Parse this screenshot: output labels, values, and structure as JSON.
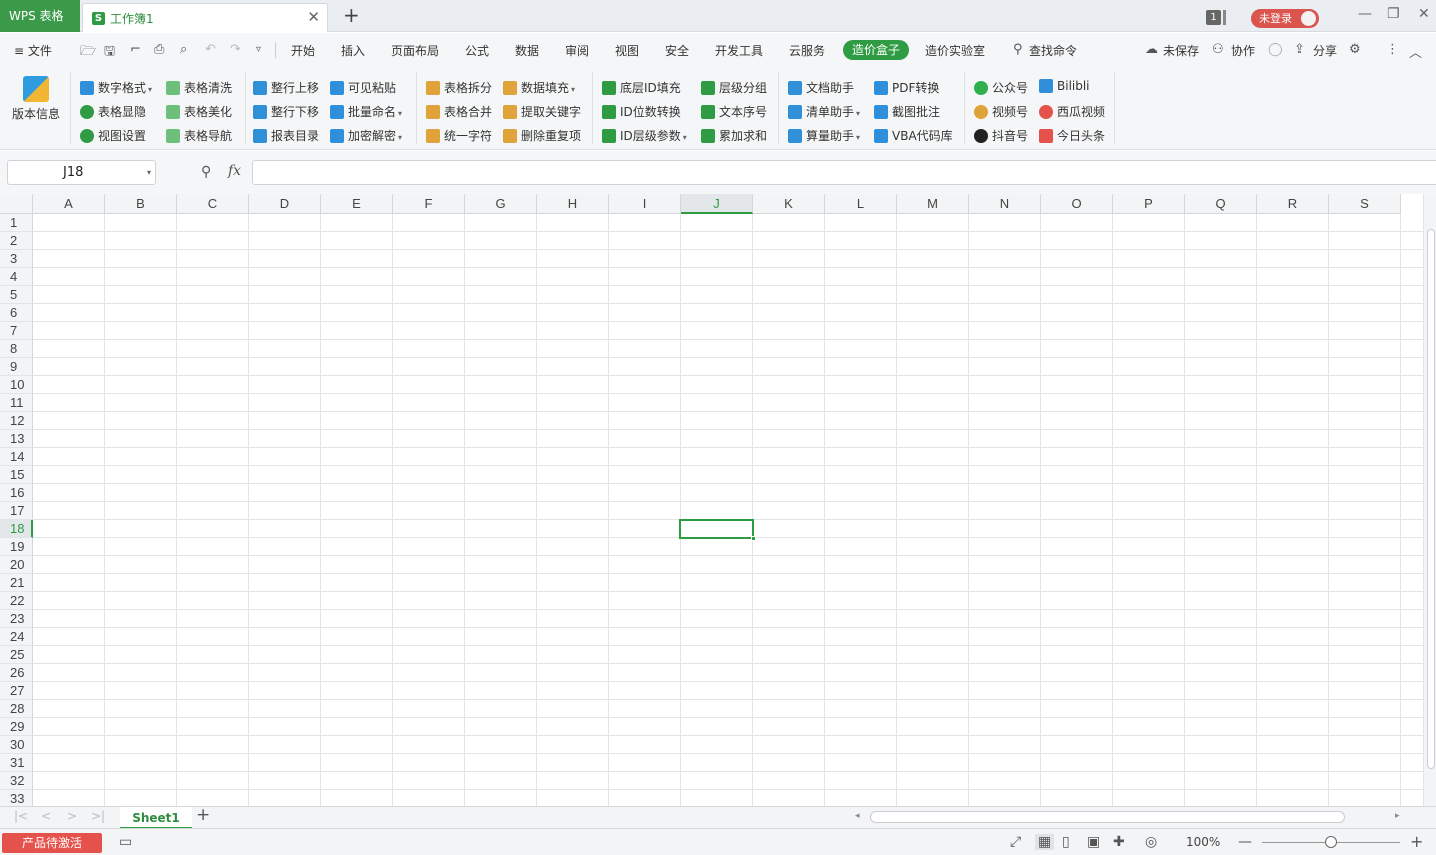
{
  "titlebar": {
    "app_name": "WPS 表格",
    "doc_title": "工作簿1",
    "doc_icon_letter": "S",
    "close_glyph": "✕",
    "new_tab_glyph": "+",
    "window_count": "1",
    "login_label": "未登录",
    "minimize_glyph": "—",
    "restore_glyph": "❐",
    "close_window_glyph": "✕"
  },
  "menubar": {
    "file_label": "≡ 文件",
    "tabs": [
      "开始",
      "插入",
      "页面布局",
      "公式",
      "数据",
      "审阅",
      "视图",
      "安全",
      "开发工具",
      "云服务",
      "造价盒子",
      "造价实验室"
    ],
    "active_tab": "造价盒子",
    "search_label": "查找命令",
    "unsaved_label": "未保存",
    "collab_label": "协作",
    "share_label": "分享"
  },
  "ribbon": {
    "version_info": "版本信息",
    "buttons": [
      {
        "label": "数字格式",
        "color": "#2f8fd8"
      },
      {
        "label": "表格显隐",
        "color": "#2f9c44"
      },
      {
        "label": "视图设置",
        "color": "#2f9c44"
      },
      {
        "label": "表格清洗",
        "color": "#2f9c44"
      },
      {
        "label": "表格美化",
        "color": "#2f9c44"
      },
      {
        "label": "表格导航",
        "color": "#2f9c44"
      },
      {
        "label": "整行上移",
        "color": "#2f8fd8"
      },
      {
        "label": "整行下移",
        "color": "#2f8fd8"
      },
      {
        "label": "报表目录",
        "color": "#2f8fd8"
      },
      {
        "label": "可见粘贴",
        "color": "#2f8fd8"
      },
      {
        "label": "批量命名",
        "color": "#2f8fd8"
      },
      {
        "label": "加密解密",
        "color": "#2f8fd8"
      },
      {
        "label": "表格拆分",
        "color": "#e0a33a"
      },
      {
        "label": "表格合并",
        "color": "#e0a33a"
      },
      {
        "label": "统一字符",
        "color": "#e0a33a"
      },
      {
        "label": "数据填充",
        "color": "#e0a33a"
      },
      {
        "label": "提取关键字",
        "color": "#e0a33a"
      },
      {
        "label": "删除重复项",
        "color": "#e0a33a"
      },
      {
        "label": "底层ID填充",
        "color": "#2f9c44"
      },
      {
        "label": "ID位数转换",
        "color": "#2f9c44"
      },
      {
        "label": "ID层级参数",
        "color": "#2f9c44"
      },
      {
        "label": "层级分组",
        "color": "#2f9c44"
      },
      {
        "label": "文本序号",
        "color": "#2f9c44"
      },
      {
        "label": "累加求和",
        "color": "#2f9c44"
      },
      {
        "label": "文档助手",
        "color": "#2f8fd8"
      },
      {
        "label": "清单助手",
        "color": "#2f8fd8"
      },
      {
        "label": "算量助手",
        "color": "#2f8fd8"
      },
      {
        "label": "PDF转换",
        "color": "#2f8fd8"
      },
      {
        "label": "截图批注",
        "color": "#2f8fd8"
      },
      {
        "label": "VBA代码库",
        "color": "#2f8fd8"
      },
      {
        "label": "公众号",
        "color": "#2fb04a"
      },
      {
        "label": "视频号",
        "color": "#e0a33a"
      },
      {
        "label": "抖音号",
        "color": "#222222"
      },
      {
        "label": "Bilibli",
        "color": "#2f8fd8"
      },
      {
        "label": "西瓜视频",
        "color": "#e5514b"
      },
      {
        "label": "今日头条",
        "color": "#e5514b"
      }
    ]
  },
  "formula": {
    "cell_ref": "J18",
    "fx_label": "fx",
    "zoom_glyph": "⚲"
  },
  "grid": {
    "columns": [
      "A",
      "B",
      "C",
      "D",
      "E",
      "F",
      "G",
      "H",
      "I",
      "J",
      "K",
      "L",
      "M",
      "N",
      "O",
      "P",
      "Q",
      "R",
      "S"
    ],
    "selected_column": "J",
    "rows": [
      "1",
      "2",
      "3",
      "4",
      "5",
      "6",
      "7",
      "8",
      "9",
      "10",
      "11",
      "12",
      "13",
      "14",
      "15",
      "16",
      "17",
      "18",
      "19",
      "20",
      "21",
      "22",
      "23",
      "24",
      "25",
      "26",
      "27",
      "28",
      "29",
      "30",
      "31",
      "32",
      "33"
    ],
    "selected_row": "18"
  },
  "sheets": {
    "tabs": [
      "Sheet1"
    ],
    "add_glyph": "+"
  },
  "status": {
    "activate_label": "产品待激活",
    "zoom_level": "100%",
    "zoom_minus": "—",
    "zoom_plus": "+",
    "accent_color": "#2f9c44"
  }
}
